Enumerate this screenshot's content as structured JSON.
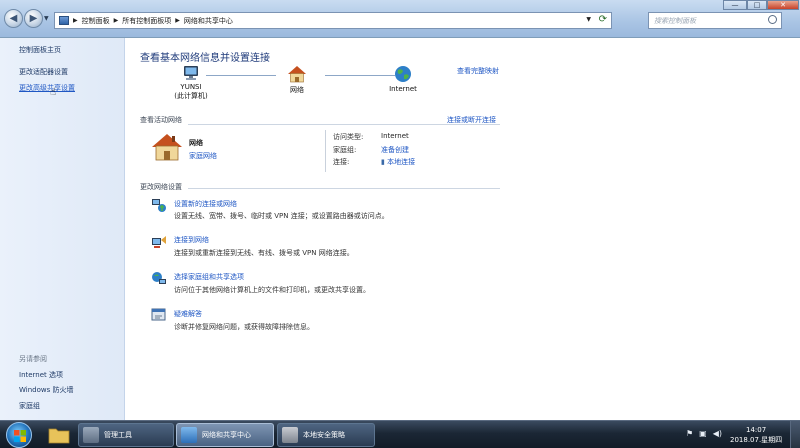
{
  "address": {
    "crumbs": [
      "控制面板",
      "所有控制面板项",
      "网络和共享中心"
    ],
    "search_placeholder": "搜索控制面板",
    "window_controls": [
      "—",
      "□",
      "✕"
    ]
  },
  "sidebar": {
    "home": "控制面板主页",
    "links": [
      "更改适配器设置",
      "更改高级共享设置"
    ],
    "see_also": "另请参阅",
    "see_also_links": [
      "Internet 选项",
      "Windows 防火墙",
      "家庭组"
    ]
  },
  "main": {
    "title": "查看基本网络信息并设置连接",
    "full_map": "查看完整映射",
    "map": [
      {
        "label": "YUNSI",
        "sub": "(此计算机)"
      },
      {
        "label": "网络",
        "sub": ""
      },
      {
        "label": "Internet",
        "sub": ""
      }
    ],
    "active_networks_label": "查看活动网络",
    "connect_link": "连接或断开连接",
    "network": {
      "name": "网络",
      "type": "家庭网络",
      "access_type_key": "访问类型:",
      "access_type_value": "Internet",
      "homegroup_key": "家庭组:",
      "homegroup_value": "准备创建",
      "connections_key": "连接:",
      "connections_value": "本地连接"
    },
    "change_settings_label": "更改网络设置",
    "tasks": [
      {
        "title": "设置新的连接或网络",
        "desc": "设置无线、宽带、拨号、临时或 VPN 连接；或设置路由器或访问点。",
        "icon": "new-connection-icon"
      },
      {
        "title": "连接到网络",
        "desc": "连接到或重新连接到无线、有线、拨号或 VPN 网络连接。",
        "icon": "connect-network-icon"
      },
      {
        "title": "选择家庭组和共享选项",
        "desc": "访问位于其他网络计算机上的文件和打印机，或更改共享设置。",
        "icon": "homegroup-icon"
      },
      {
        "title": "疑难解答",
        "desc": "诊断并修复网络问题，或获得故障排除信息。",
        "icon": "troubleshoot-icon"
      }
    ]
  },
  "taskbar": {
    "items": [
      {
        "label": "管理工具",
        "active": false
      },
      {
        "label": "网络和共享中心",
        "active": true
      },
      {
        "label": "本地安全策略",
        "active": false
      }
    ],
    "clock_time": "14:07",
    "clock_date": "2018.07.星期四"
  }
}
